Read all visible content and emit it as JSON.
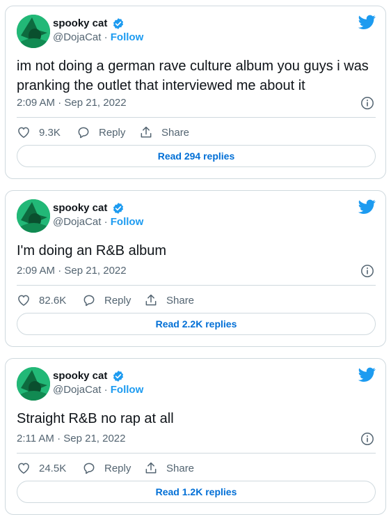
{
  "author": {
    "display_name": "spooky cat",
    "handle": "@DojaCat",
    "separator": "·",
    "follow_label": "Follow"
  },
  "icons": {
    "verified": "verified-badge-icon",
    "bird": "twitter-bird-icon",
    "info": "info-icon",
    "like": "heart-icon",
    "reply": "reply-bubble-icon",
    "share": "share-upload-icon"
  },
  "colors": {
    "accent": "#1d9bf0",
    "link": "#006fd6",
    "border": "#cfd9de",
    "muted": "#536471"
  },
  "tweets": [
    {
      "text": "im not doing a german rave culture album you guys i was pranking the outlet that interviewed me about it",
      "timestamp": "2:09 AM · Sep 21, 2022",
      "likes": "9.3K",
      "reply_label": "Reply",
      "share_label": "Share",
      "read_replies": "Read 294 replies"
    },
    {
      "text": "I'm doing an R&B album",
      "timestamp": "2:09 AM · Sep 21, 2022",
      "likes": "82.6K",
      "reply_label": "Reply",
      "share_label": "Share",
      "read_replies": "Read 2.2K replies"
    },
    {
      "text": "Straight R&B no rap at all",
      "timestamp": "2:11 AM · Sep 21, 2022",
      "likes": "24.5K",
      "reply_label": "Reply",
      "share_label": "Share",
      "read_replies": "Read 1.2K replies"
    }
  ]
}
